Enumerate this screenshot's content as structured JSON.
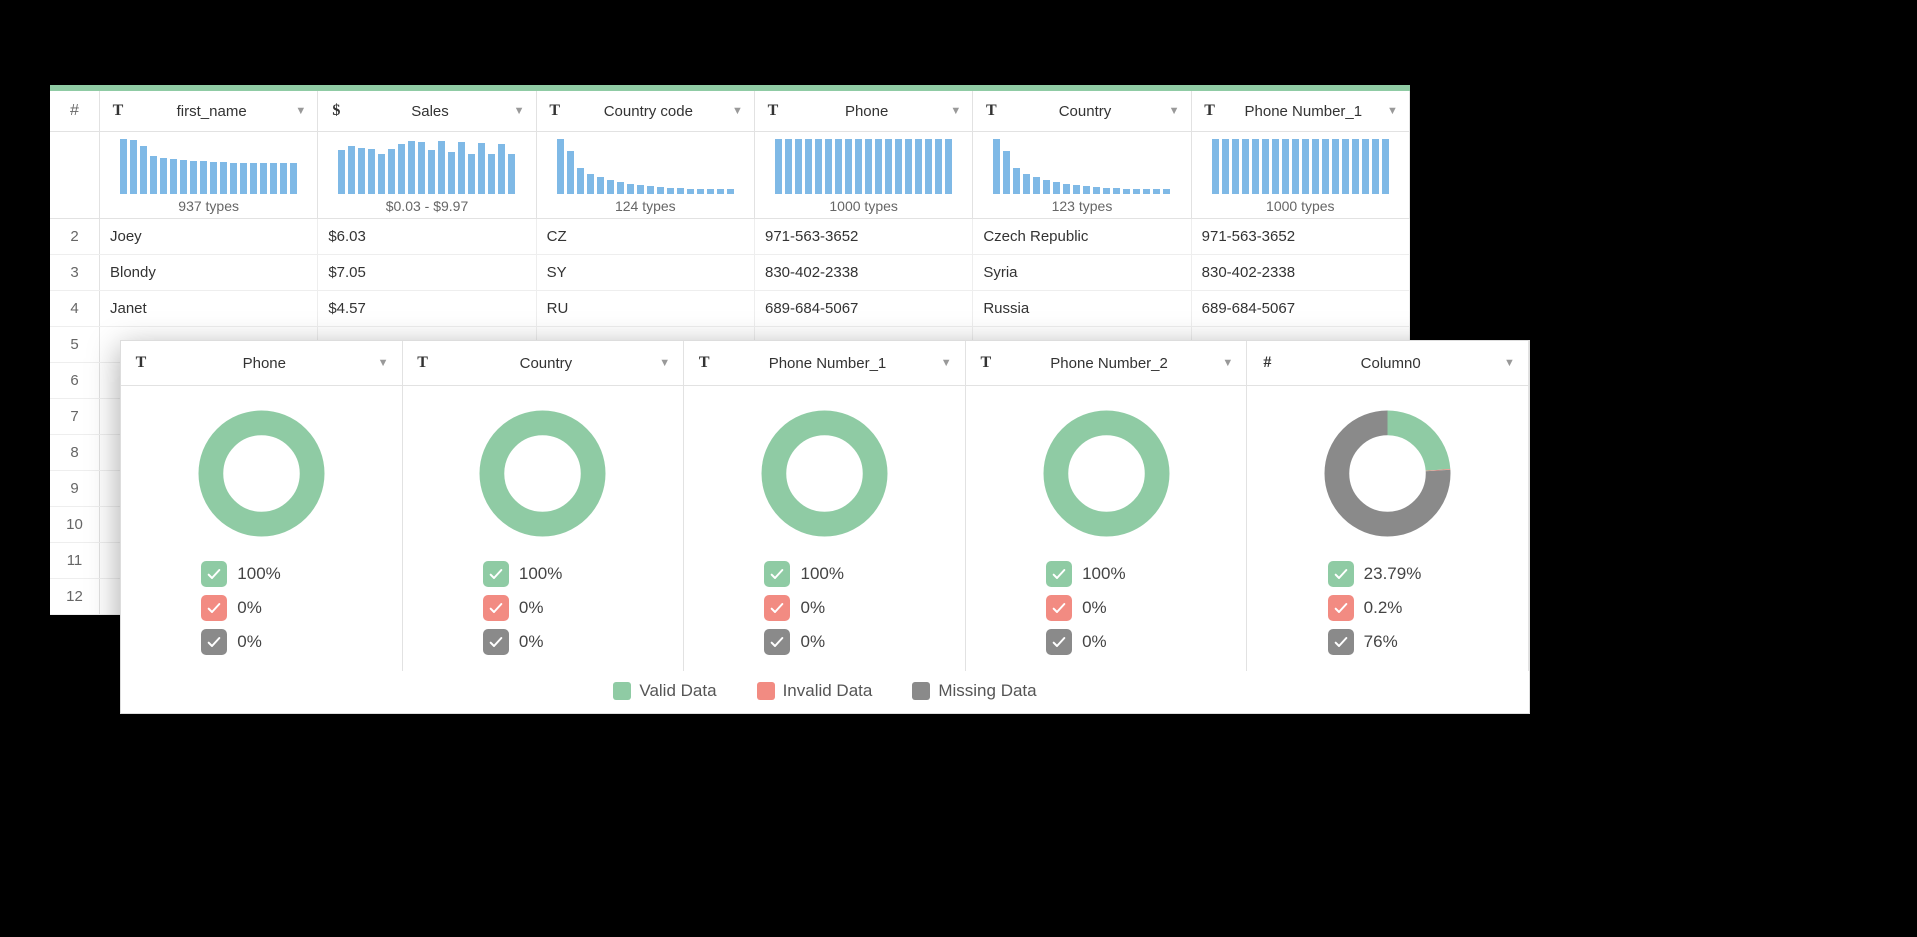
{
  "grid": {
    "hash": "#",
    "columns": [
      {
        "type_icon": "T",
        "label": "first_name",
        "hist_summary": "937 types",
        "hist_bars": [
          55,
          54,
          48,
          38,
          36,
          35,
          34,
          33,
          33,
          32,
          32,
          31,
          31,
          31,
          31,
          31,
          31,
          31
        ]
      },
      {
        "type_icon": "$",
        "label": "Sales",
        "hist_summary": "$0.03 - $9.97",
        "hist_bars": [
          44,
          48,
          46,
          45,
          40,
          45,
          50,
          53,
          52,
          44,
          53,
          42,
          52,
          40,
          51,
          40,
          50,
          40
        ]
      },
      {
        "type_icon": "T",
        "label": "Country code",
        "hist_summary": "124 types",
        "hist_bars": [
          55,
          43,
          26,
          20,
          17,
          14,
          12,
          10,
          9,
          8,
          7,
          6,
          6,
          5,
          5,
          5,
          5,
          5
        ]
      },
      {
        "type_icon": "T",
        "label": "Phone",
        "hist_summary": "1000 types",
        "hist_bars": [
          55,
          55,
          55,
          55,
          55,
          55,
          55,
          55,
          55,
          55,
          55,
          55,
          55,
          55,
          55,
          55,
          55,
          55
        ]
      },
      {
        "type_icon": "T",
        "label": "Country",
        "hist_summary": "123 types",
        "hist_bars": [
          55,
          43,
          26,
          20,
          17,
          14,
          12,
          10,
          9,
          8,
          7,
          6,
          6,
          5,
          5,
          5,
          5,
          5
        ]
      },
      {
        "type_icon": "T",
        "label": "Phone Number_1",
        "hist_summary": "1000 types",
        "hist_bars": [
          55,
          55,
          55,
          55,
          55,
          55,
          55,
          55,
          55,
          55,
          55,
          55,
          55,
          55,
          55,
          55,
          55,
          55
        ]
      }
    ],
    "rows": [
      {
        "num": "2",
        "cells": [
          "Joey",
          "$6.03",
          "CZ",
          "971-563-3652",
          "Czech Republic",
          "971-563-3652"
        ]
      },
      {
        "num": "3",
        "cells": [
          "Blondy",
          "$7.05",
          "SY",
          "830-402-2338",
          "Syria",
          "830-402-2338"
        ]
      },
      {
        "num": "4",
        "cells": [
          "Janet",
          "$4.57",
          "RU",
          "689-684-5067",
          "Russia",
          "689-684-5067"
        ]
      }
    ],
    "empty_row_nums": [
      "5",
      "6",
      "7",
      "8",
      "9",
      "10",
      "11",
      "12"
    ]
  },
  "quality": {
    "columns": [
      {
        "type_icon": "T",
        "label": "Phone",
        "valid": 100,
        "valid_txt": "100%",
        "invalid": 0,
        "invalid_txt": "0%",
        "missing": 0,
        "missing_txt": "0%"
      },
      {
        "type_icon": "T",
        "label": "Country",
        "valid": 100,
        "valid_txt": "100%",
        "invalid": 0,
        "invalid_txt": "0%",
        "missing": 0,
        "missing_txt": "0%"
      },
      {
        "type_icon": "T",
        "label": "Phone Number_1",
        "valid": 100,
        "valid_txt": "100%",
        "invalid": 0,
        "invalid_txt": "0%",
        "missing": 0,
        "missing_txt": "0%"
      },
      {
        "type_icon": "T",
        "label": "Phone Number_2",
        "valid": 100,
        "valid_txt": "100%",
        "invalid": 0,
        "invalid_txt": "0%",
        "missing": 0,
        "missing_txt": "0%"
      },
      {
        "type_icon": "#",
        "label": "Column0",
        "valid": 23.79,
        "valid_txt": "23.79%",
        "invalid": 0.2,
        "invalid_txt": "0.2%",
        "missing": 76,
        "missing_txt": "76%"
      }
    ],
    "legend": {
      "valid": "Valid Data",
      "invalid": "Invalid Data",
      "missing": "Missing Data"
    }
  },
  "colors": {
    "valid": "#8FCBA4",
    "invalid": "#F28B82",
    "missing": "#8A8A8A",
    "bar": "#7FB9E6"
  },
  "chart_data": [
    {
      "type": "bar",
      "title": "first_name distribution",
      "values": [
        55,
        54,
        48,
        38,
        36,
        35,
        34,
        33,
        33,
        32,
        32,
        31,
        31,
        31,
        31,
        31,
        31,
        31
      ],
      "summary": "937 types"
    },
    {
      "type": "bar",
      "title": "Sales distribution",
      "values": [
        44,
        48,
        46,
        45,
        40,
        45,
        50,
        53,
        52,
        44,
        53,
        42,
        52,
        40,
        51,
        40,
        50,
        40
      ],
      "summary": "$0.03 - $9.97"
    },
    {
      "type": "bar",
      "title": "Country code distribution",
      "values": [
        55,
        43,
        26,
        20,
        17,
        14,
        12,
        10,
        9,
        8,
        7,
        6,
        6,
        5,
        5,
        5,
        5,
        5
      ],
      "summary": "124 types"
    },
    {
      "type": "bar",
      "title": "Phone distribution",
      "values": [
        55,
        55,
        55,
        55,
        55,
        55,
        55,
        55,
        55,
        55,
        55,
        55,
        55,
        55,
        55,
        55,
        55,
        55
      ],
      "summary": "1000 types"
    },
    {
      "type": "bar",
      "title": "Country distribution",
      "values": [
        55,
        43,
        26,
        20,
        17,
        14,
        12,
        10,
        9,
        8,
        7,
        6,
        6,
        5,
        5,
        5,
        5,
        5
      ],
      "summary": "123 types"
    },
    {
      "type": "bar",
      "title": "Phone Number_1 distribution",
      "values": [
        55,
        55,
        55,
        55,
        55,
        55,
        55,
        55,
        55,
        55,
        55,
        55,
        55,
        55,
        55,
        55,
        55,
        55
      ],
      "summary": "1000 types"
    },
    {
      "type": "pie",
      "title": "Phone quality",
      "series": [
        {
          "name": "Valid",
          "value": 100
        },
        {
          "name": "Invalid",
          "value": 0
        },
        {
          "name": "Missing",
          "value": 0
        }
      ]
    },
    {
      "type": "pie",
      "title": "Country quality",
      "series": [
        {
          "name": "Valid",
          "value": 100
        },
        {
          "name": "Invalid",
          "value": 0
        },
        {
          "name": "Missing",
          "value": 0
        }
      ]
    },
    {
      "type": "pie",
      "title": "Phone Number_1 quality",
      "series": [
        {
          "name": "Valid",
          "value": 100
        },
        {
          "name": "Invalid",
          "value": 0
        },
        {
          "name": "Missing",
          "value": 0
        }
      ]
    },
    {
      "type": "pie",
      "title": "Phone Number_2 quality",
      "series": [
        {
          "name": "Valid",
          "value": 100
        },
        {
          "name": "Invalid",
          "value": 0
        },
        {
          "name": "Missing",
          "value": 0
        }
      ]
    },
    {
      "type": "pie",
      "title": "Column0 quality",
      "series": [
        {
          "name": "Valid",
          "value": 23.79
        },
        {
          "name": "Invalid",
          "value": 0.2
        },
        {
          "name": "Missing",
          "value": 76
        }
      ]
    }
  ]
}
